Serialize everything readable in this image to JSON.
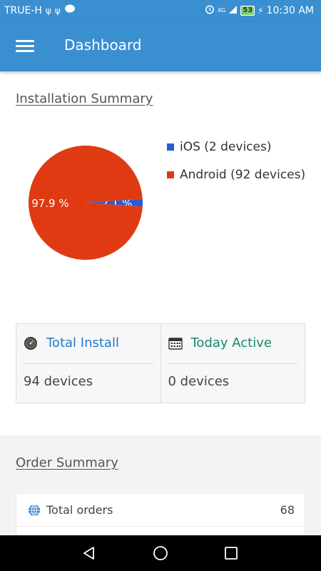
{
  "status_bar": {
    "carrier": "TRUE-H",
    "network": "4G",
    "battery": "53",
    "time": "10:30 AM"
  },
  "app_bar": {
    "title": "Dashboard"
  },
  "installation_summary": {
    "title": "Installation Summary",
    "legend": [
      {
        "label": "iOS (2 devices)",
        "color": "#2a5bd7"
      },
      {
        "label": "Android (92 devices)",
        "color": "#e03a12"
      }
    ]
  },
  "chart_data": {
    "type": "pie",
    "categories": [
      "iOS",
      "Android"
    ],
    "values": [
      2,
      92
    ],
    "slice_labels": [
      "2.1 %",
      "97.9 %"
    ],
    "colors": [
      "#2a5bd7",
      "#e03a12"
    ],
    "legend_placement": "right"
  },
  "stats": {
    "total_install": {
      "label": "Total Install",
      "value": "94 devices",
      "color": "#1f7bd0"
    },
    "today_active": {
      "label": "Today Active",
      "value": "0 devices",
      "color": "#148a6e"
    }
  },
  "order_summary": {
    "title": "Order Summary",
    "rows": [
      {
        "label": "Total orders",
        "value": "68"
      }
    ]
  },
  "icons": {
    "menu": "hamburger-icon",
    "total_install": "gauge-icon",
    "today_active": "calendar-icon",
    "total_orders": "globe-icon",
    "nav_back": "back-triangle-icon",
    "nav_home": "home-circle-icon",
    "nav_recents": "recents-square-icon"
  }
}
